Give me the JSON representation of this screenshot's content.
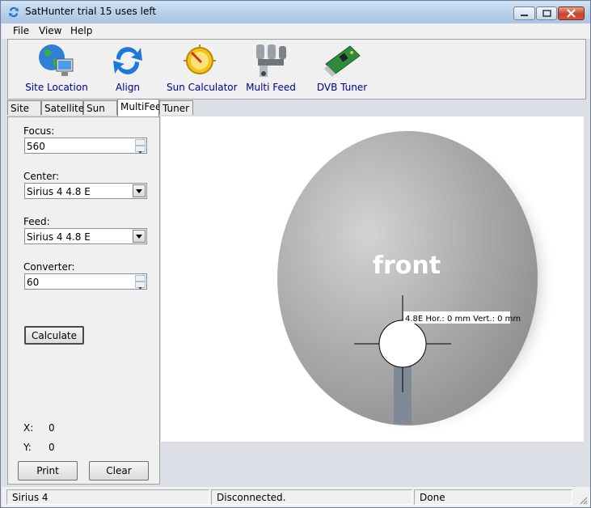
{
  "window": {
    "title": "SatHunter trial 15 uses left"
  },
  "menu": {
    "file": "File",
    "view": "View",
    "help": "Help"
  },
  "toolbar": {
    "site_location": "Site Location",
    "align": "Align",
    "sun_calculator": "Sun Calculator",
    "multi_feed": "Multi Feed",
    "dvb_tuner": "DVB Tuner"
  },
  "tabs": {
    "site": "Site",
    "satellites": "Satellites",
    "sun": "Sun",
    "multifeed": "MultiFeed",
    "tuner": "Tuner"
  },
  "form": {
    "focus_label": "Focus:",
    "focus_value": "560",
    "center_label": "Center:",
    "center_value": "Sirius 4 4.8 E",
    "feed_label": "Feed:",
    "feed_value": "Sirius 4 4.8 E",
    "converter_label": "Converter:",
    "converter_value": "60",
    "calculate": "Calculate",
    "x_label": "X:",
    "x_value": "0",
    "y_label": "Y:",
    "y_value": "0",
    "print": "Print",
    "clear": "Clear"
  },
  "canvas": {
    "front_text": "front",
    "feed_label": "4.8E Hor.: 0 mm Vert.: 0 mm"
  },
  "status": {
    "satellite": "Sirius 4",
    "connection": "Disconnected.",
    "state": "Done"
  },
  "colors": {
    "link_blue": "#00008b",
    "dish_gray": "#9e9e9e",
    "panel": "#f0f0f0"
  }
}
